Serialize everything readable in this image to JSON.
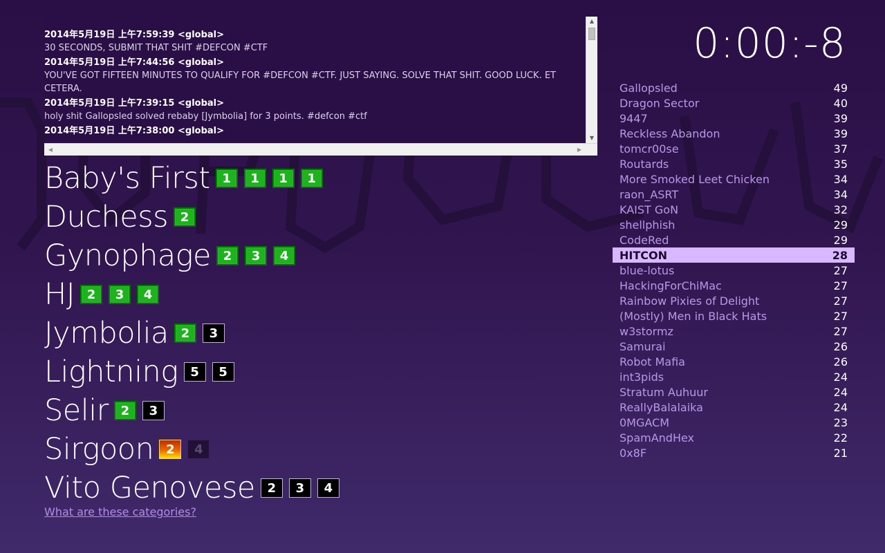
{
  "timer": "0:00:-8",
  "log": [
    {
      "time": "2014年5月19日 上午7:59:39",
      "channel": "<global>",
      "message": "30 SECONDS, SUBMIT THAT SHIT #DEFCON #CTF"
    },
    {
      "time": "2014年5月19日 上午7:44:56",
      "channel": "<global>",
      "message": "YOU'VE GOT FIFTEEN MINUTES TO QUALIFY FOR #DEFCON #CTF. JUST SAYING. SOLVE THAT SHIT. GOOD LUCK. ET CETERA."
    },
    {
      "time": "2014年5月19日 上午7:39:15",
      "channel": "<global>",
      "message": "holy shit Gallopsled solved rebaby [Jymbolia] for 3 points. #defcon #ctf"
    },
    {
      "time": "2014年5月19日 上午7:38:00",
      "channel": "<global>",
      "message": ""
    }
  ],
  "categories": [
    {
      "name": "Baby's First",
      "challenges": [
        {
          "points": "1",
          "state": "solved"
        },
        {
          "points": "1",
          "state": "solved"
        },
        {
          "points": "1",
          "state": "solved"
        },
        {
          "points": "1",
          "state": "solved"
        }
      ]
    },
    {
      "name": "Duchess",
      "challenges": [
        {
          "points": "2",
          "state": "solved"
        }
      ]
    },
    {
      "name": "Gynophage",
      "challenges": [
        {
          "points": "2",
          "state": "solved"
        },
        {
          "points": "3",
          "state": "solved"
        },
        {
          "points": "4",
          "state": "solved"
        }
      ]
    },
    {
      "name": "HJ",
      "challenges": [
        {
          "points": "2",
          "state": "solved"
        },
        {
          "points": "3",
          "state": "solved"
        },
        {
          "points": "4",
          "state": "solved"
        }
      ]
    },
    {
      "name": "Jymbolia",
      "challenges": [
        {
          "points": "2",
          "state": "solved"
        },
        {
          "points": "3",
          "state": "open"
        }
      ]
    },
    {
      "name": "Lightning",
      "challenges": [
        {
          "points": "5",
          "state": "open"
        },
        {
          "points": "5",
          "state": "open"
        }
      ]
    },
    {
      "name": "Selir",
      "challenges": [
        {
          "points": "2",
          "state": "solved"
        },
        {
          "points": "3",
          "state": "open"
        }
      ]
    },
    {
      "name": "Sirgoon",
      "challenges": [
        {
          "points": "2",
          "state": "hot"
        },
        {
          "points": "4",
          "state": "dim"
        }
      ]
    },
    {
      "name": "Vito Genovese",
      "challenges": [
        {
          "points": "2",
          "state": "open"
        },
        {
          "points": "3",
          "state": "open"
        },
        {
          "points": "4",
          "state": "open"
        }
      ]
    }
  ],
  "help_link": "What are these categories?",
  "scoreboard": [
    {
      "team": "Gallopsled",
      "score": "49"
    },
    {
      "team": "Dragon Sector",
      "score": "40"
    },
    {
      "team": "9447",
      "score": "39"
    },
    {
      "team": "Reckless Abandon",
      "score": "39"
    },
    {
      "team": "tomcr00se",
      "score": "37"
    },
    {
      "team": "Routards",
      "score": "35"
    },
    {
      "team": "More Smoked Leet Chicken",
      "score": "34"
    },
    {
      "team": "raon_ASRT",
      "score": "34"
    },
    {
      "team": "KAIST GoN",
      "score": "32"
    },
    {
      "team": "shellphish",
      "score": "29"
    },
    {
      "team": "CodeRed",
      "score": "29"
    },
    {
      "team": "HITCON",
      "score": "28",
      "highlight": true
    },
    {
      "team": "blue-lotus",
      "score": "27"
    },
    {
      "team": "HackingForChiMac",
      "score": "27"
    },
    {
      "team": "Rainbow Pixies of Delight",
      "score": "27"
    },
    {
      "team": "(Mostly) Men in Black Hats",
      "score": "27"
    },
    {
      "team": "w3stormz",
      "score": "27"
    },
    {
      "team": "Samurai",
      "score": "26"
    },
    {
      "team": "Robot Mafia",
      "score": "26"
    },
    {
      "team": "int3pids",
      "score": "24"
    },
    {
      "team": "Stratum Auhuur",
      "score": "24"
    },
    {
      "team": "ReallyBalalaika",
      "score": "24"
    },
    {
      "team": "0MGACM",
      "score": "23"
    },
    {
      "team": "SpamAndHex",
      "score": "22"
    },
    {
      "team": "0x8F",
      "score": "21"
    }
  ],
  "colors": {
    "background_top": "#2a0f46",
    "background_bottom": "#402a6a",
    "solved": "#1fb21f",
    "open": "#000000",
    "highlight_row": "#d9b8ff",
    "link": "#b48be6"
  },
  "icons": [
    "scroll-up-arrow-icon",
    "scroll-down-arrow-icon",
    "scroll-left-arrow-icon",
    "scroll-right-arrow-icon"
  ]
}
